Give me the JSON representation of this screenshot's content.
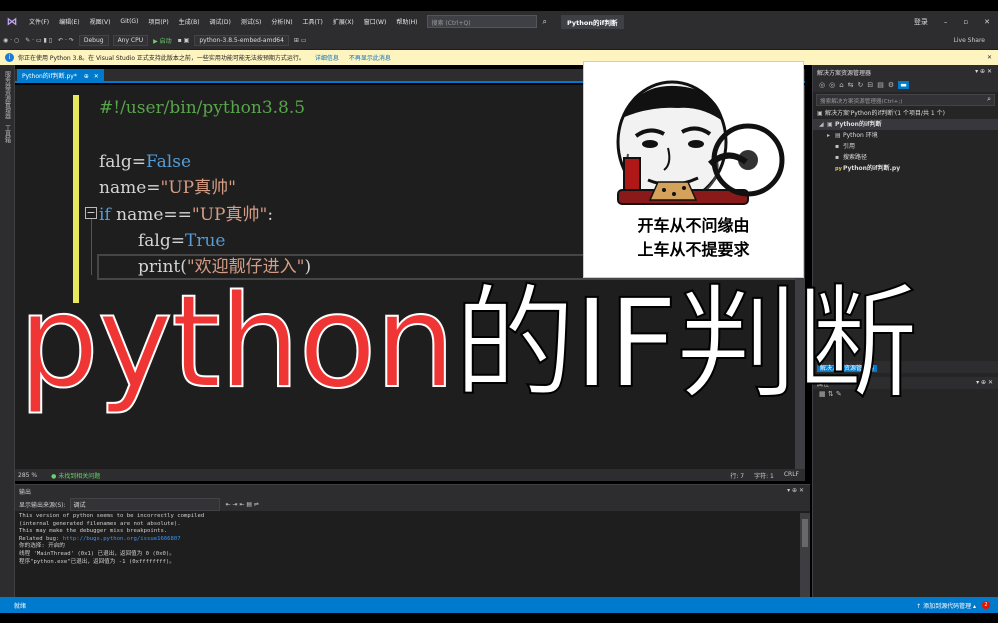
{
  "menu": [
    "文件(F)",
    "编辑(E)",
    "视图(V)",
    "Git(G)",
    "项目(P)",
    "生成(B)",
    "调试(D)",
    "测试(S)",
    "分析(N)",
    "工具(T)",
    "扩展(X)",
    "窗口(W)",
    "帮助(H)"
  ],
  "search": {
    "placeholder": "搜索 (Ctrl+Q)"
  },
  "project_title": "Python的if判断",
  "window": {
    "login": "登录",
    "min": "–",
    "max": "▫",
    "close": "✕",
    "live_share": "Live Share"
  },
  "toolbar": {
    "config": "Debug",
    "platform": "Any CPU",
    "start": "▶ 启动",
    "env": "python-3.8.5-embed-amd64"
  },
  "infobar": {
    "message": "你正在使用 Python 3.8。在 Visual Studio 正式支持此版本之前，一些实用功能可能无法按预期方式运行。",
    "link1": "详细信息",
    "link2": "不再显示此消息",
    "close": "✕"
  },
  "leftstrip": {
    "label1": "服务器资源管理器",
    "label2": "工具箱"
  },
  "tab": {
    "label": "Python的if判断.py*",
    "pin": "⊕",
    "close": "✕"
  },
  "code": {
    "line1": "#!/user/bin/python3.8.5",
    "line2a": "falg",
    "line2b": "=",
    "line2c": "False",
    "line3a": "name",
    "line3b": "=",
    "line3c": "\"UP真帅\"",
    "line4a": "if",
    "line4b": " name==",
    "line4c": "\"UP真帅\"",
    "line4d": ":",
    "line5a": "falg",
    "line5b": "=",
    "line5c": "True",
    "line6a": "print(",
    "line6b": "\"欢迎靓仔进入\"",
    "line6c": ")",
    "fold": "−"
  },
  "editor_status": {
    "zoom": "285 %",
    "issues": "未找到相关问题",
    "line": "行: 7",
    "col": "字符: 1",
    "eol": "CRLF"
  },
  "output": {
    "title": "输出",
    "source_label": "显示输出来源(S):",
    "source_value": "调试",
    "lines": [
      "This version of python seems to be incorrectly compiled",
      "(internal generated filenames are not absolute).",
      "This may make the debugger miss breakpoints.",
      "Related bug: "
    ],
    "bug_link": "http://bugs.python.org/issue1666807",
    "lines2": [
      "你的选择: 开启的",
      "线程 'MainThread' (0x1) 已退出，返回值为 0 (0x0)。",
      "程序\"python.exe\"已退出，返回值为 -1 (0xffffffff)。"
    ],
    "ctrl": "▾ ⊕ ✕"
  },
  "solution": {
    "title": "解决方案资源管理器",
    "ctrl": "▾ ⊕ ✕",
    "search_placeholder": "搜索解决方案资源管理器(Ctrl+;)",
    "items": [
      {
        "label": "解决方案'Python的if判断'(1 个项目/共 1 个)",
        "icon": "▣",
        "arrow": ""
      },
      {
        "label": "Python的if判断",
        "icon": "▣",
        "arrow": "◢"
      },
      {
        "label": "Python 环境",
        "icon": "▤",
        "arrow": "▸"
      },
      {
        "label": "引用",
        "icon": "▪",
        "arrow": ""
      },
      {
        "label": "搜索路径",
        "icon": "▪",
        "arrow": ""
      },
      {
        "label": "Python的if判断.py",
        "icon": "py",
        "arrow": ""
      }
    ]
  },
  "properties": {
    "tab": "解决方案资源管理器",
    "title": "属性",
    "ctrl": "▾ ⊕ ✕"
  },
  "status": {
    "ready": "就绪",
    "source_control": "↑ 添加到源代码管理 ▴",
    "badge": "2"
  },
  "meme": {
    "caption1": "开车从不问缘由",
    "caption2": "上车从不提要求"
  },
  "overlay": {
    "en": "python",
    "zh": "的IF判断"
  },
  "colors": {
    "accent": "#007acc",
    "title_red": "#f03535",
    "keyword": "#569cd6",
    "string": "#d69d85",
    "comment": "#57a64a"
  }
}
